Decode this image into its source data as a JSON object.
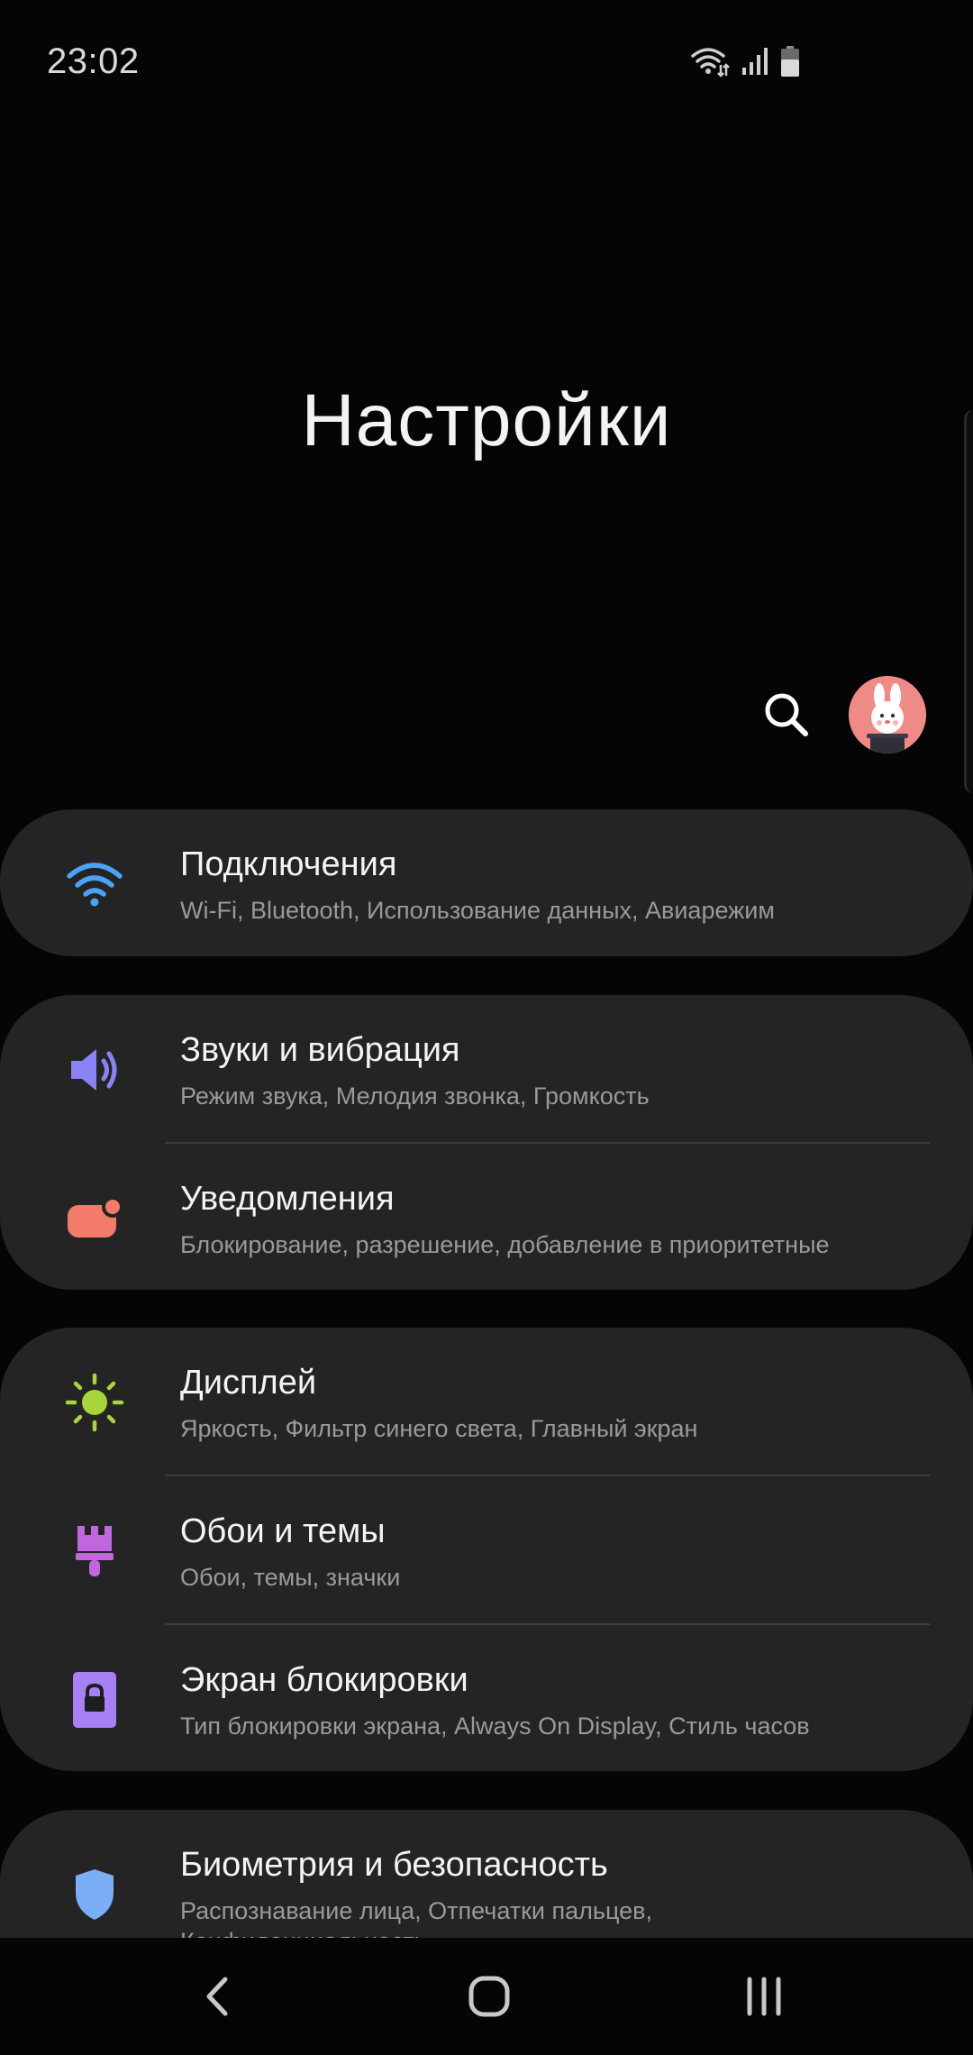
{
  "status_bar": {
    "time": "23:02",
    "icons": [
      "wifi-icon",
      "signal-icon",
      "battery-icon"
    ]
  },
  "header": {
    "title": "Настройки"
  },
  "actions": {
    "search_icon": "search-icon",
    "avatar_icon": "profile-avatar"
  },
  "cards": [
    {
      "items": [
        {
          "title": "Подключения",
          "subtitle": "Wi-Fi, Bluetooth, Использование данных, Авиарежим",
          "icon": "wifi-icon",
          "icon_color": "#4aa3f5"
        }
      ]
    },
    {
      "items": [
        {
          "title": "Звуки и вибрация",
          "subtitle": "Режим звука, Мелодия звонка, Громкость",
          "icon": "volume-icon",
          "icon_color": "#8a83f5"
        },
        {
          "title": "Уведомления",
          "subtitle": "Блокирование, разрешение, добавление в приоритетные",
          "icon": "notification-icon",
          "icon_color": "#f47a6a"
        }
      ]
    },
    {
      "items": [
        {
          "title": "Дисплей",
          "subtitle": "Яркость, Фильтр синего света, Главный экран",
          "icon": "brightness-icon",
          "icon_color": "#a6d63a"
        },
        {
          "title": "Обои и темы",
          "subtitle": "Обои, темы, значки",
          "icon": "brush-icon",
          "icon_color": "#c067e0"
        },
        {
          "title": "Экран блокировки",
          "subtitle": "Тип блокировки экрана, Always On Display, Стиль часов",
          "icon": "lock-icon",
          "icon_color": "#a880f5"
        }
      ]
    },
    {
      "items": [
        {
          "title": "Биометрия и безопасность",
          "subtitle": "Распознавание лица, Отпечатки пальцев,",
          "subtitle2": "Конфиденциальность",
          "icon": "shield-icon",
          "icon_color": "#7aaef5"
        }
      ]
    }
  ],
  "nav": {
    "back": "back-icon",
    "home": "home-icon",
    "recents": "recents-icon"
  }
}
